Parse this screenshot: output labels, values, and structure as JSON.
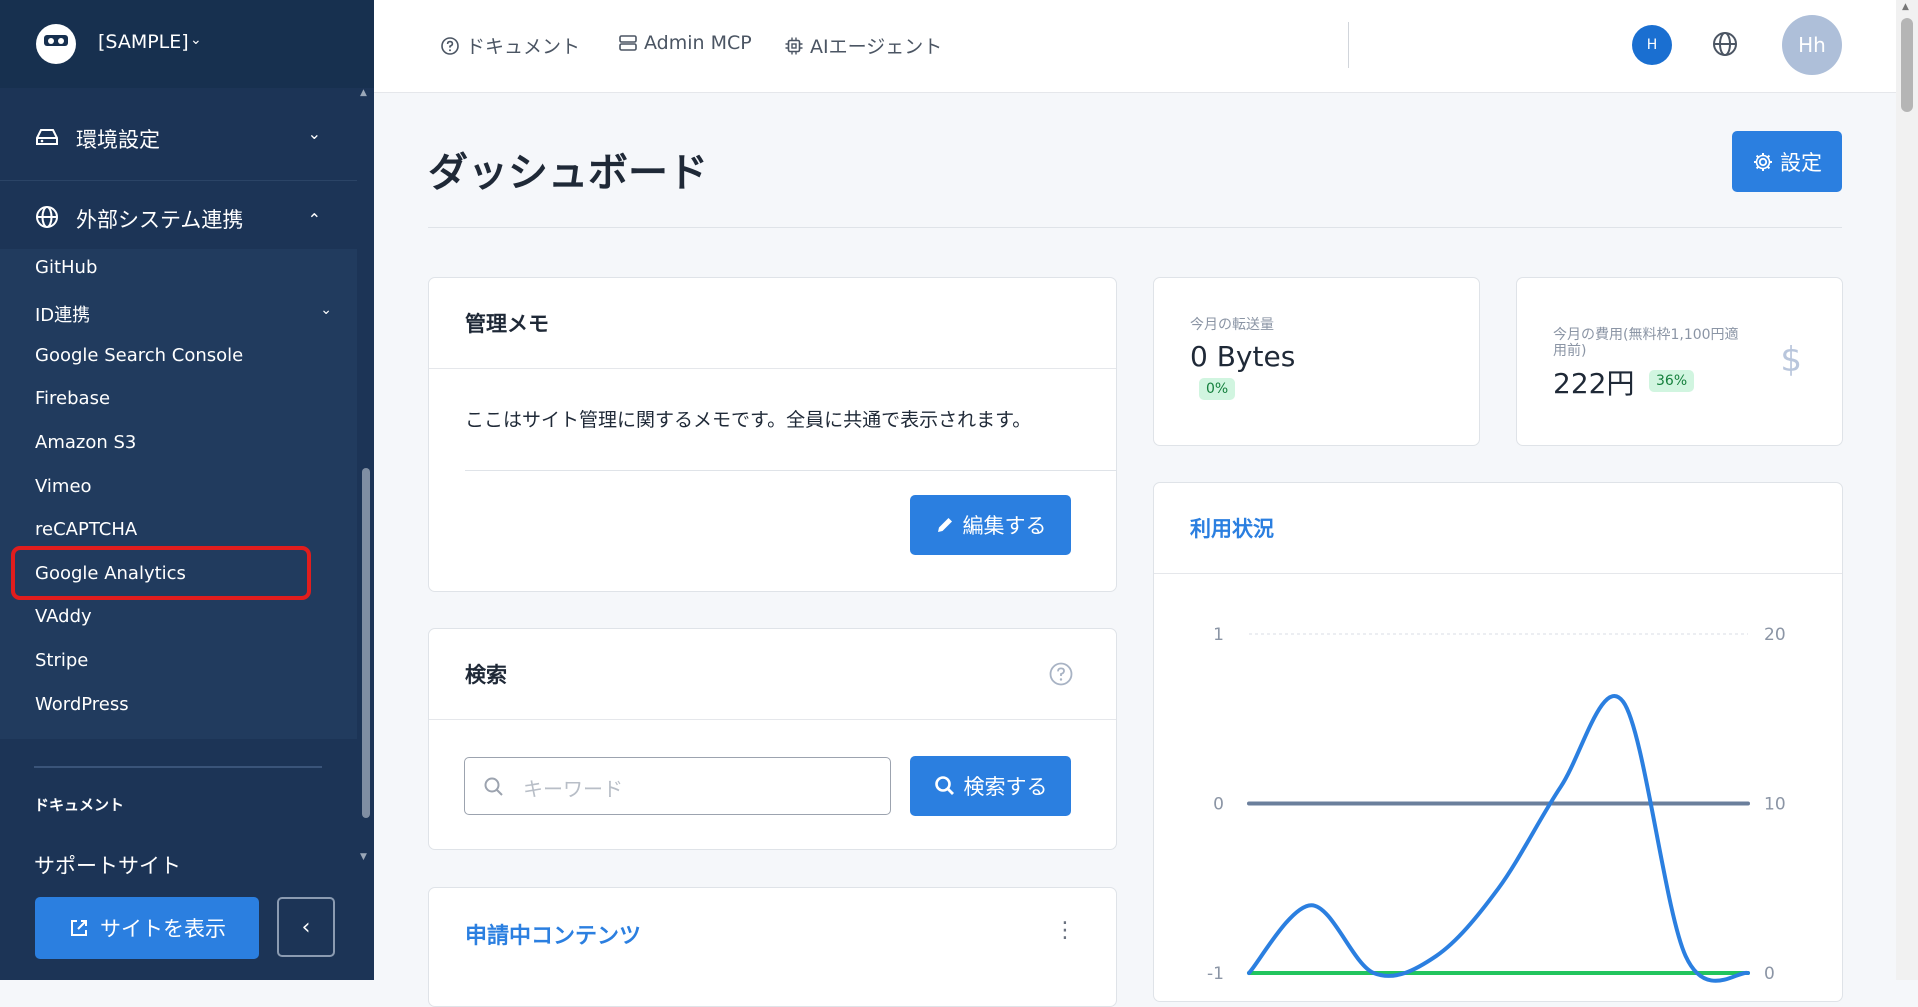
{
  "sidebar": {
    "site_name": "[SAMPLE]",
    "sections": [
      {
        "label": "環境設定",
        "icon": "drive-icon",
        "expanded": false
      },
      {
        "label": "外部システム連携",
        "icon": "globe-icon",
        "expanded": true
      }
    ],
    "integration_items": [
      "GitHub",
      "ID連携",
      "Google Search Console",
      "Firebase",
      "Amazon S3",
      "Vimeo",
      "reCAPTCHA",
      "Google Analytics",
      "VAddy",
      "Stripe",
      "WordPress"
    ],
    "highlighted_item": "Google Analytics",
    "doc_label": "ドキュメント",
    "support_label": "サポートサイト",
    "view_site_label": "サイトを表示",
    "collapse_label": "‹"
  },
  "topbar": {
    "links": [
      {
        "label": "ドキュメント",
        "icon": "help-circle-icon"
      },
      {
        "label": "Admin MCP",
        "icon": "server-icon"
      },
      {
        "label": "AIエージェント",
        "icon": "cpu-icon"
      }
    ],
    "small_avatar": "H",
    "avatar": "Hh"
  },
  "page": {
    "title": "ダッシュボード",
    "settings_label": "設定"
  },
  "memo": {
    "title": "管理メモ",
    "text": "ここはサイト管理に関するメモです。全員に共通で表示されます。",
    "edit_label": "編集する"
  },
  "search": {
    "title": "検索",
    "placeholder": "キーワード",
    "value": "",
    "button_label": "検索する"
  },
  "pending": {
    "title": "申請中コンテンツ"
  },
  "stats": {
    "transfer": {
      "label": "今月の転送量",
      "value": "0 Bytes",
      "badge": "0%"
    },
    "cost": {
      "label_line1": "今月の費用(無料枠1,100円適",
      "label_line2": "用前)",
      "value": "222円",
      "badge": "36%"
    }
  },
  "usage": {
    "title": "利用状況"
  },
  "colors": {
    "sidebar_bg": "#1c3456",
    "accent": "#2b7fe0",
    "highlight_border": "#e11d1d",
    "badge_bg": "#d1f5e0",
    "badge_text": "#15803d",
    "series_blue": "#2b7fe0",
    "series_gray": "#6b7f9c",
    "series_green": "#22c55e"
  },
  "chart_data": {
    "type": "line",
    "left_axis": {
      "ticks": [
        "1",
        "0",
        "-1"
      ],
      "ylim": [
        -1,
        1
      ]
    },
    "right_axis": {
      "ticks": [
        "20",
        "10",
        "0"
      ],
      "ylim": [
        0,
        20
      ]
    },
    "grid": "top line only",
    "series": [
      {
        "axis": "right",
        "color": "#2b7fe0",
        "x": [
          0,
          1,
          2,
          3,
          4,
          5,
          6,
          7,
          8
        ],
        "values": [
          0,
          4,
          0,
          1,
          5,
          11,
          16,
          1,
          0
        ]
      },
      {
        "axis": "left",
        "color": "#6b7f9c",
        "x": [
          0,
          8
        ],
        "values": [
          0,
          0
        ]
      },
      {
        "axis": "right",
        "color": "#22c55e",
        "x": [
          0,
          8
        ],
        "values": [
          0,
          0
        ]
      }
    ]
  }
}
